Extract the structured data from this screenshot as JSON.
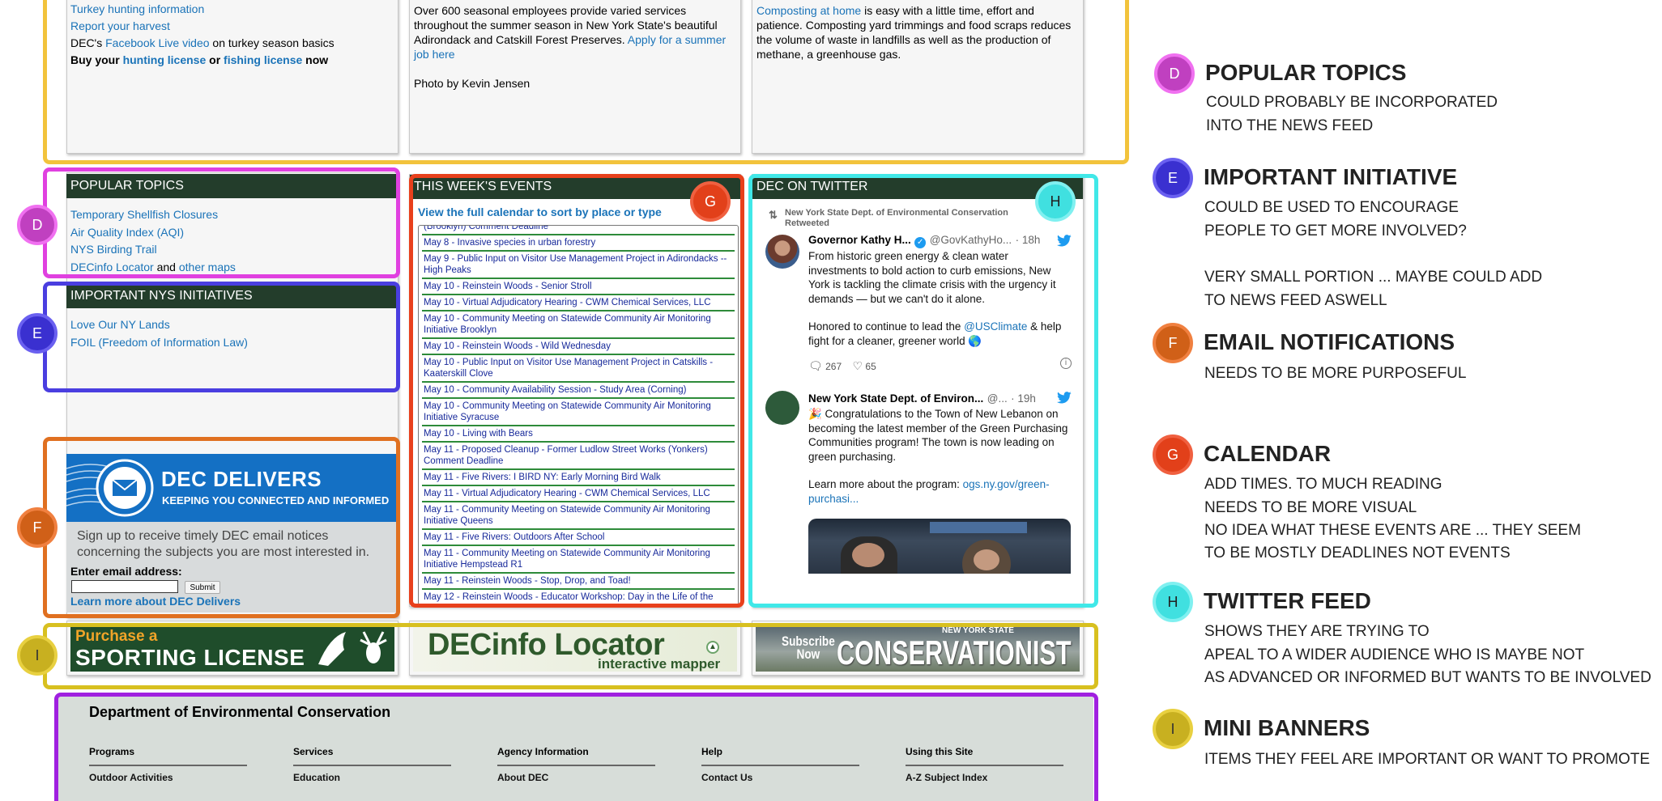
{
  "top": {
    "left_lines": [
      {
        "text": "Turkey hunting information",
        "link": true
      },
      {
        "text": "Report your harvest",
        "link": true
      }
    ],
    "left_dec_prefix": "DEC's ",
    "left_dec_link": "Facebook Live video",
    "left_dec_suffix": " on turkey season basics",
    "left_buy_prefix": "Buy your ",
    "left_buy_link1": "hunting license",
    "left_buy_mid": " or ",
    "left_buy_link2": "fishing license",
    "left_buy_suffix": " now",
    "middle_text": "Over 600 seasonal employees provide varied services throughout the summer season in New York State's beautiful Adirondack and Catskill Forest Preserves.",
    "middle_link": "Apply for a summer job here",
    "middle_photo": "Photo by Kevin Jensen",
    "right_link": "Composting at home",
    "right_text": " is easy with a little time, effort and patience. Composting yard trimmings and food scraps reduces the volume of waste in landfills as well as the production of methane, a greenhouse gas."
  },
  "popular": {
    "title": "POPULAR TOPICS",
    "items": [
      "Temporary Shellfish Closures",
      "Air Quality Index (AQI)",
      "NYS Birding Trail"
    ],
    "last_link1": "DECinfo Locator",
    "last_mid": " and ",
    "last_link2": "other maps"
  },
  "initiatives": {
    "title": "IMPORTANT NYS INITIATIVES",
    "items": [
      "Love Our NY Lands",
      "FOIL (Freedom of Information Law)"
    ]
  },
  "delivers": {
    "brand": "DEC DELIVERS",
    "tagline": "KEEPING YOU CONNECTED AND INFORMED",
    "description": "Sign up to receive timely DEC email notices concerning the subjects you are most interested in.",
    "email_label": "Enter email address:",
    "email_value": "",
    "submit_label": "Submit",
    "learn_more": "Learn more about DEC Delivers"
  },
  "events": {
    "title": "THIS WEEK'S EVENTS",
    "calendar_link": "View the full calendar to sort by place or type",
    "cut_top": "(Brooklyn) Comment Deadline",
    "items": [
      "May 8 - Invasive species in urban forestry",
      "May 9 - Public Input on Visitor Use Management Project in Adirondacks -- High Peaks",
      "May 10 - Reinstein Woods - Senior Stroll",
      "May 10 - Virtual Adjudicatory Hearing - CWM Chemical Services, LLC",
      "May 10 - Community Meeting on Statewide Community Air Monitoring Initiative Brooklyn",
      "May 10 - Reinstein Woods - Wild Wednesday",
      "May 10 - Public Input on Visitor Use Management Project in Catskills - Kaaterskill Clove",
      "May 10 - Community Availability Session - Study Area (Corning)",
      "May 10 - Community Meeting on Statewide Community Air Monitoring Initiative Syracuse",
      "May 10 - Living with Bears",
      "May 11 - Proposed Cleanup - Former Ludlow Street Works (Yonkers) Comment Deadline",
      "May 11 - Five Rivers: I BIRD NY: Early Morning Bird Walk",
      "May 11 - Virtual Adjudicatory Hearing - CWM Chemical Services, LLC",
      "May 11 - Community Meeting on Statewide Community Air Monitoring Initiative Queens",
      "May 11 - Five Rivers: Outdoors After School",
      "May 11 - Community Meeting on Statewide Community Air Monitoring Initiative Hempstead R1",
      "May 11 - Reinstein Woods - Stop, Drop, and Toad!",
      "May 12 - Reinstein Woods - Educator Workshop: Day in the Life of the"
    ]
  },
  "twitter": {
    "title": "DEC ON TWITTER",
    "retweet_label": "New York State Dept. of Environmental Conservation Retweeted",
    "tweet1": {
      "name": "Governor Kathy H...",
      "handle": "@GovKathyHo...",
      "time": "· 18h",
      "body1": "From historic green energy & clean water investments to bold action to curb emissions, New York is tackling the climate crisis with the urgency it demands — but we can't do it alone.",
      "body2_prefix": "Honored to continue to lead the ",
      "body2_link": "@USClimate",
      "body2_suffix": " & help fight for a cleaner, greener world 🌎",
      "replies": "267",
      "likes": "65"
    },
    "tweet2": {
      "name": "New York State Dept. of Environ...",
      "handle": "@...",
      "time": "· 19h",
      "body1": "🎉 Congratulations to the Town of New Lebanon on becoming the latest member of the Green Purchasing Communities program! The town is now leading on green purchasing.",
      "body2_prefix": "Learn more about the program: ",
      "body2_link": "ogs.ny.gov/green-purchasi..."
    }
  },
  "banners": {
    "sporting_small": "Purchase a",
    "sporting_big": "SPORTING LICENSE",
    "decinfo_big": "DECinfo Locator",
    "decinfo_small": "interactive mapper",
    "cons_small1": "Subscribe",
    "cons_small2": "Now",
    "cons_state": "NEW YORK STATE",
    "cons_big": "CONSERVATIONIST"
  },
  "footer": {
    "title": "Department of Environmental Conservation",
    "columns": [
      {
        "head": "Programs",
        "link": "Outdoor Activities"
      },
      {
        "head": "Services",
        "link": "Education"
      },
      {
        "head": "Agency Information",
        "link": "About DEC"
      },
      {
        "head": "Help",
        "link": "Contact Us"
      },
      {
        "head": "Using this Site",
        "link": "A-Z Subject Index"
      }
    ]
  },
  "badges": {
    "d": "D",
    "e": "E",
    "f": "F",
    "g": "G",
    "h": "H",
    "i": "I"
  },
  "notes": {
    "d_title": "POPULAR TOPICS",
    "d_lines": [
      "COULD PROBABLY BE INCORPORATED",
      "INTO THE NEWS FEED"
    ],
    "e_title": "IMPORTANT INITIATIVE",
    "e_lines": [
      "COULD BE USED TO ENCOURAGE",
      "PEOPLE TO GET MORE INVOLVED?",
      "",
      "VERY SMALL PORTION ... MAYBE COULD ADD",
      "TO NEWS FEED ASWELL"
    ],
    "f_title": "EMAIL NOTIFICATIONS",
    "f_lines": [
      "NEEDS TO BE MORE PURPOSEFUL"
    ],
    "g_title": "CALENDAR",
    "g_lines": [
      "ADD TIMES. TO MUCH READING",
      "NEEDS TO BE MORE VISUAL",
      "NO IDEA WHAT THESE EVENTS ARE ... THEY SEEM",
      "TO BE MOSTLY DEADLINES NOT EVENTS"
    ],
    "h_title": "TWITTER FEED",
    "h_lines": [
      "SHOWS THEY ARE TRYING TO",
      "APEAL TO A WIDER AUDIENCE WHO IS MAYBE NOT",
      "AS ADVANCED OR INFORMED BUT WANTS TO BE INVOLVED"
    ],
    "i_title": "MINI BANNERS",
    "i_lines": [
      "ITEMS THEY FEEL ARE IMPORTANT OR WANT TO PROMOTE"
    ]
  },
  "colors": {
    "yellow": "#f2c33c",
    "magenta": "#e040e0",
    "purple_blue": "#4a3ee0",
    "orange": "#e07020",
    "red": "#e8401c",
    "cyan": "#40e8e8",
    "olive": "#d8c020",
    "violet": "#a020e0",
    "header_green": "#233d2b",
    "link_blue": "#1a73b8"
  }
}
